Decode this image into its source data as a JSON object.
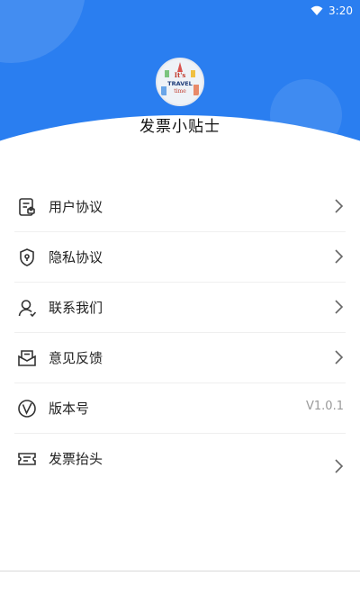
{
  "status_bar": {
    "time": "3:20"
  },
  "app": {
    "logo_text": [
      "It's",
      "TRAVEL",
      "time"
    ],
    "title": "发票小贴士"
  },
  "menu": {
    "items": [
      {
        "label": "用户协议",
        "icon": "document-icon"
      },
      {
        "label": "隐私协议",
        "icon": "shield-icon"
      },
      {
        "label": "联系我们",
        "icon": "person-icon"
      },
      {
        "label": "意见反馈",
        "icon": "envelope-icon"
      },
      {
        "label": "版本号",
        "icon": "version-icon",
        "value": "V1.0.1"
      },
      {
        "label": "发票抬头",
        "icon": "ticket-icon"
      }
    ]
  },
  "colors": {
    "header_blue": "#2a7ef0",
    "text": "#222222",
    "muted": "#999999"
  }
}
